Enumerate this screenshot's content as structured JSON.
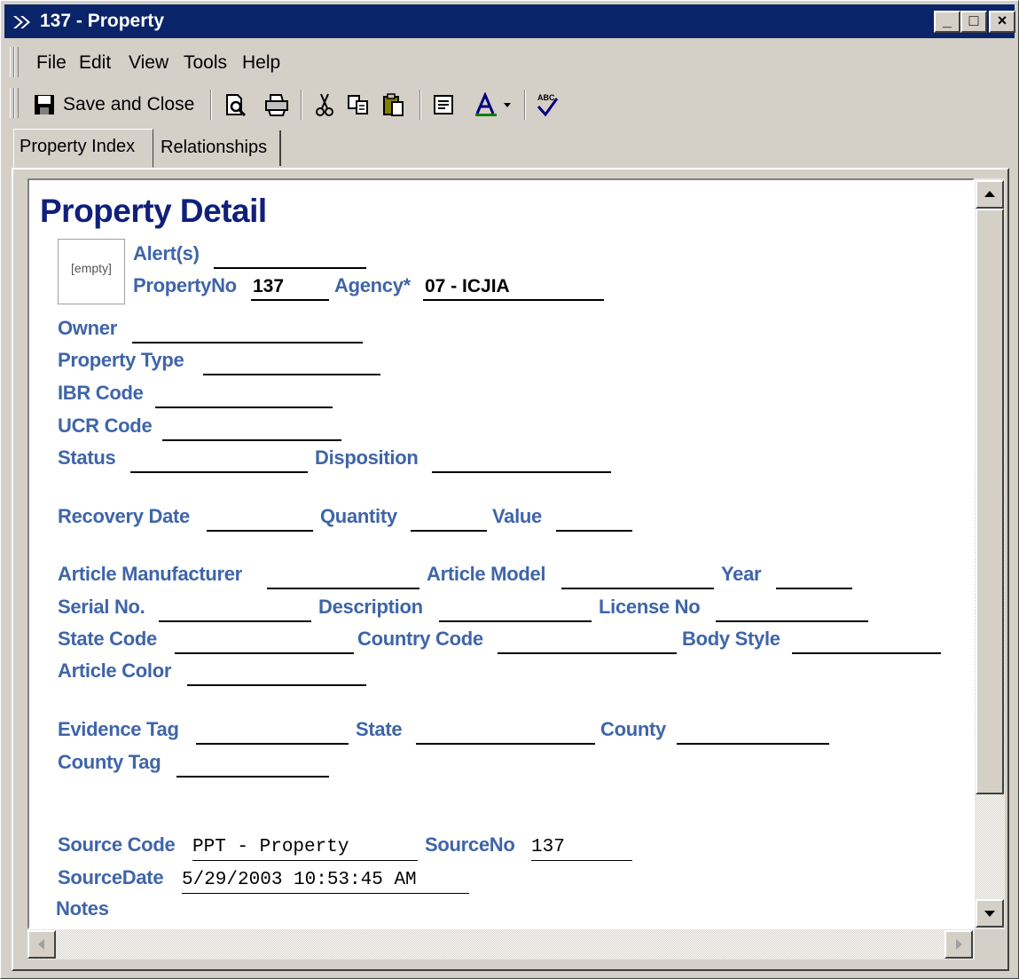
{
  "window": {
    "title": "137 - Property",
    "controls": {
      "minimize": "_",
      "maximize": "□",
      "close": "×"
    }
  },
  "menu": [
    "File",
    "Edit",
    "View",
    "Tools",
    "Help"
  ],
  "toolbar": {
    "save_close_label": "Save and Close"
  },
  "tabs": [
    "Property Index",
    "Relationships"
  ],
  "form": {
    "heading": "Property Detail",
    "photo_placeholder": "[empty]",
    "alerts_label": "Alert(s)",
    "alerts_value": "",
    "property_no_label": "PropertyNo",
    "property_no_value": "137",
    "agency_label": "Agency*",
    "agency_value": "07 - ICJIA",
    "owner_label": "Owner",
    "property_type_label": "Property Type",
    "ibr_code_label": "IBR Code",
    "ucr_code_label": "UCR Code",
    "status_label": "Status",
    "disposition_label": "Disposition",
    "recovery_date_label": "Recovery Date",
    "quantity_label": "Quantity",
    "value_label": "Value",
    "article_manufacturer_label": "Article Manufacturer",
    "article_model_label": "Article Model",
    "year_label": "Year",
    "serial_no_label": "Serial No.",
    "description_label": "Description",
    "license_no_label": "License No",
    "state_code_label": "State Code",
    "country_code_label": "Country Code",
    "body_style_label": "Body Style",
    "article_color_label": "Article Color",
    "evidence_tag_label": "Evidence Tag",
    "state_label": "State",
    "county_label": "County",
    "county_tag_label": "County Tag",
    "source_code_label": "Source Code",
    "source_code_value": "PPT - Property",
    "source_no_label": "SourceNo",
    "source_no_value": "137",
    "source_date_label": "SourceDate",
    "source_date_value": "5/29/2003 10:53:45 AM",
    "notes_label": "Notes"
  },
  "colors": {
    "title_bar": "#0a246a",
    "label": "#3f65a8",
    "heading": "#10207a",
    "face": "#d4d0c8"
  }
}
